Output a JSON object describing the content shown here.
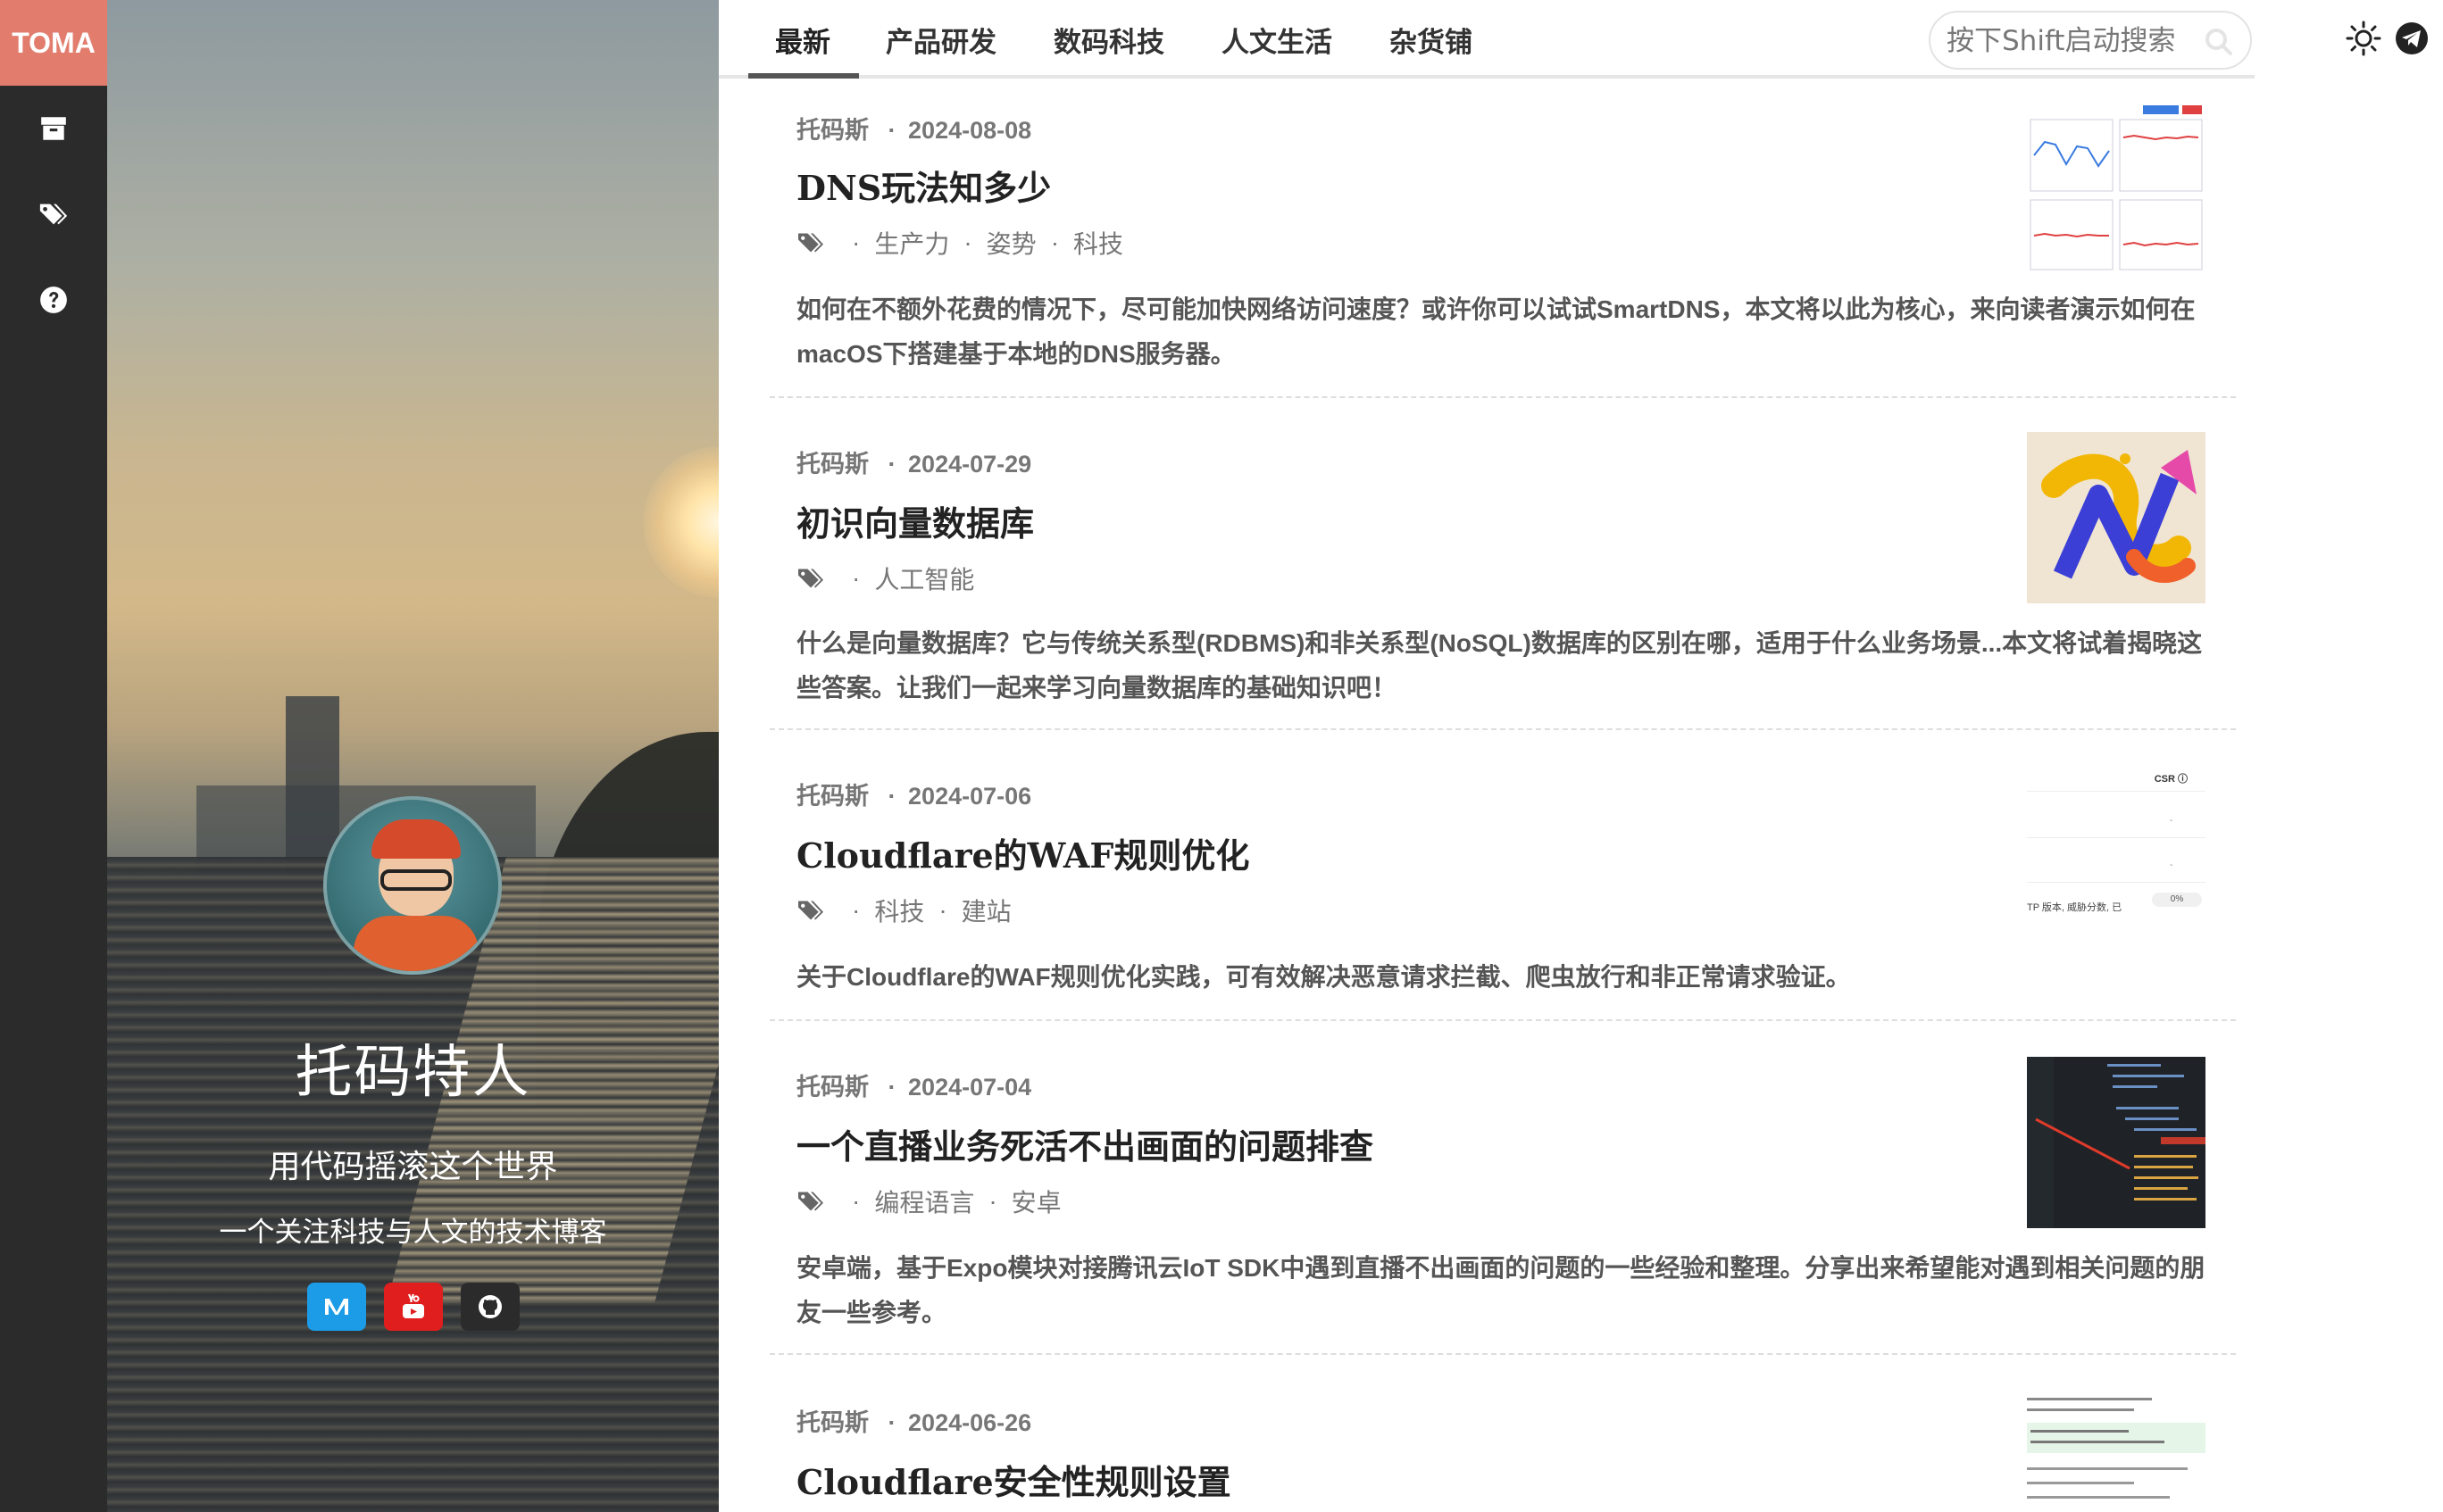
{
  "brand": {
    "label": "TOMA",
    "color": "#e27d6e"
  },
  "rail": {
    "items": [
      {
        "name": "archive-icon"
      },
      {
        "name": "tags-icon"
      },
      {
        "name": "help-icon"
      }
    ]
  },
  "profile": {
    "name": "托码特人",
    "tagline": "用代码摇滚这个世界",
    "description": "一个关注科技与人文的技术博客",
    "social": [
      {
        "name": "medium-icon",
        "color": "#1c9be6"
      },
      {
        "name": "youtube-icon",
        "color": "#e01e1e"
      },
      {
        "name": "github-icon",
        "color": "#2b2b2b"
      }
    ]
  },
  "nav": {
    "tabs": [
      "最新",
      "产品研发",
      "数码科技",
      "人文生活",
      "杂货铺"
    ],
    "active_tab": "最新",
    "search_placeholder": "按下Shift启动搜索"
  },
  "posts": [
    {
      "author": "托码斯",
      "date": "2024-08-08",
      "title": "DNS玩法知多少",
      "tags": [
        "生产力",
        "姿势",
        "科技"
      ],
      "excerpt": "如何在不额外花费的情况下，尽可能加快网络访问速度？或许你可以试试SmartDNS，本文将以此为核心，来向读者演示如何在macOS下搭建基于本地的DNS服务器。"
    },
    {
      "author": "托码斯",
      "date": "2024-07-29",
      "title": "初识向量数据库",
      "tags": [
        "人工智能"
      ],
      "excerpt": "什么是向量数据库？它与传统关系型(RDBMS)和非关系型(NoSQL)数据库的区别在哪，适用于什么业务场景...本文将试着揭晓这些答案。让我们一起来学习向量数据库的基础知识吧！"
    },
    {
      "author": "托码斯",
      "date": "2024-07-06",
      "title": "Cloudflare的WAF规则优化",
      "tags": [
        "科技",
        "建站"
      ],
      "excerpt": "关于Cloudflare的WAF规则优化实践，可有效解决恶意请求拦截、爬虫放行和非正常请求验证。",
      "thumb_text": {
        "header": "CSR ⓘ",
        "footer": "TP 版本, 威胁分数, 已",
        "pct": "0%"
      }
    },
    {
      "author": "托码斯",
      "date": "2024-07-04",
      "title": "一个直播业务死活不出画面的问题排查",
      "tags": [
        "编程语言",
        "安卓"
      ],
      "excerpt": "安卓端，基于Expo模块对接腾讯云IoT SDK中遇到直播不出画面的问题的一些经验和整理。分享出来希望能对遇到相关问题的朋友一些参考。"
    },
    {
      "author": "托码斯",
      "date": "2024-06-26",
      "title": "Cloudflare安全性规则设置",
      "tags": [],
      "excerpt": ""
    }
  ],
  "meta_separator": "·"
}
